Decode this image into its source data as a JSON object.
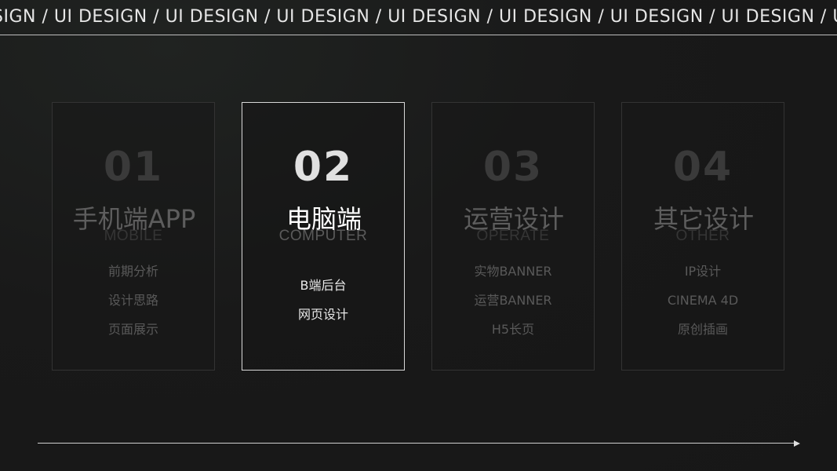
{
  "marquee": {
    "text": "SIGN / UI DESIGN / UI DESIGN / UI DESIGN / UI DESIGN / UI DESIGN / UI DESIGN / UI DESIGN / UI DESIGN / UI DE"
  },
  "cards": [
    {
      "number": "01",
      "title": "手机端APP",
      "subtitle": "MOBILE",
      "items": [
        "前期分析",
        "设计思路",
        "页面展示"
      ]
    },
    {
      "number": "02",
      "title": "电脑端",
      "subtitle": "COMPUTER",
      "items": [
        "B端后台",
        "网页设计"
      ]
    },
    {
      "number": "03",
      "title": "运营设计",
      "subtitle": "OPERATE",
      "items": [
        "实物BANNER",
        "运营BANNER",
        "H5长页"
      ]
    },
    {
      "number": "04",
      "title": "其它设计",
      "subtitle": "OTHER",
      "items": [
        "IP设计",
        "CINEMA 4D",
        "原创插画"
      ]
    }
  ],
  "active_card": "02",
  "colors": {
    "background": "#191919",
    "active_border": "#d8d8d8",
    "inactive_border": "#333333",
    "active_text": "#ffffff",
    "inactive_text": "#5d5d5d"
  },
  "icons": {
    "timeline": "arrow-right-icon"
  }
}
